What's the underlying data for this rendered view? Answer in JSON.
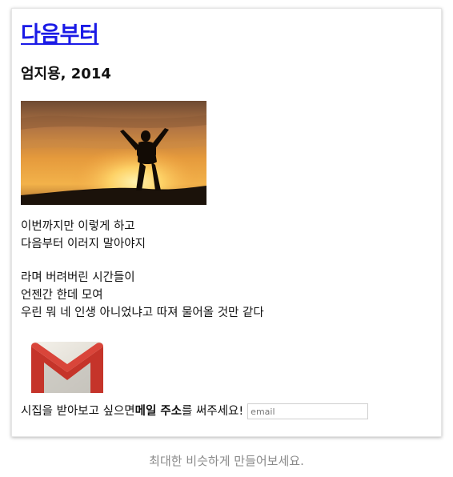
{
  "card": {
    "title": "다음부터",
    "subtitle": "엄지용, 2014",
    "poem": {
      "stanza1": [
        "이번까지만 이렇게 하고",
        "다음부터 이러지 말아야지"
      ],
      "stanza2": [
        "라며 버려버린 시간들이",
        "언젠간 한데 모여",
        "우린 뭐 네 인생 아니었냐고 따져 물어올 것만 같다"
      ]
    },
    "subscribe": {
      "before": "시집을 받아보고 싶으면 ",
      "bold": "메일 주소",
      "after": "를 써주세요!",
      "placeholder": "email"
    }
  },
  "caption": "최대한 비슷하게 만들어보세요.",
  "icons": {
    "photo": "sunset-silhouette-photo",
    "mail": "gmail-icon"
  }
}
